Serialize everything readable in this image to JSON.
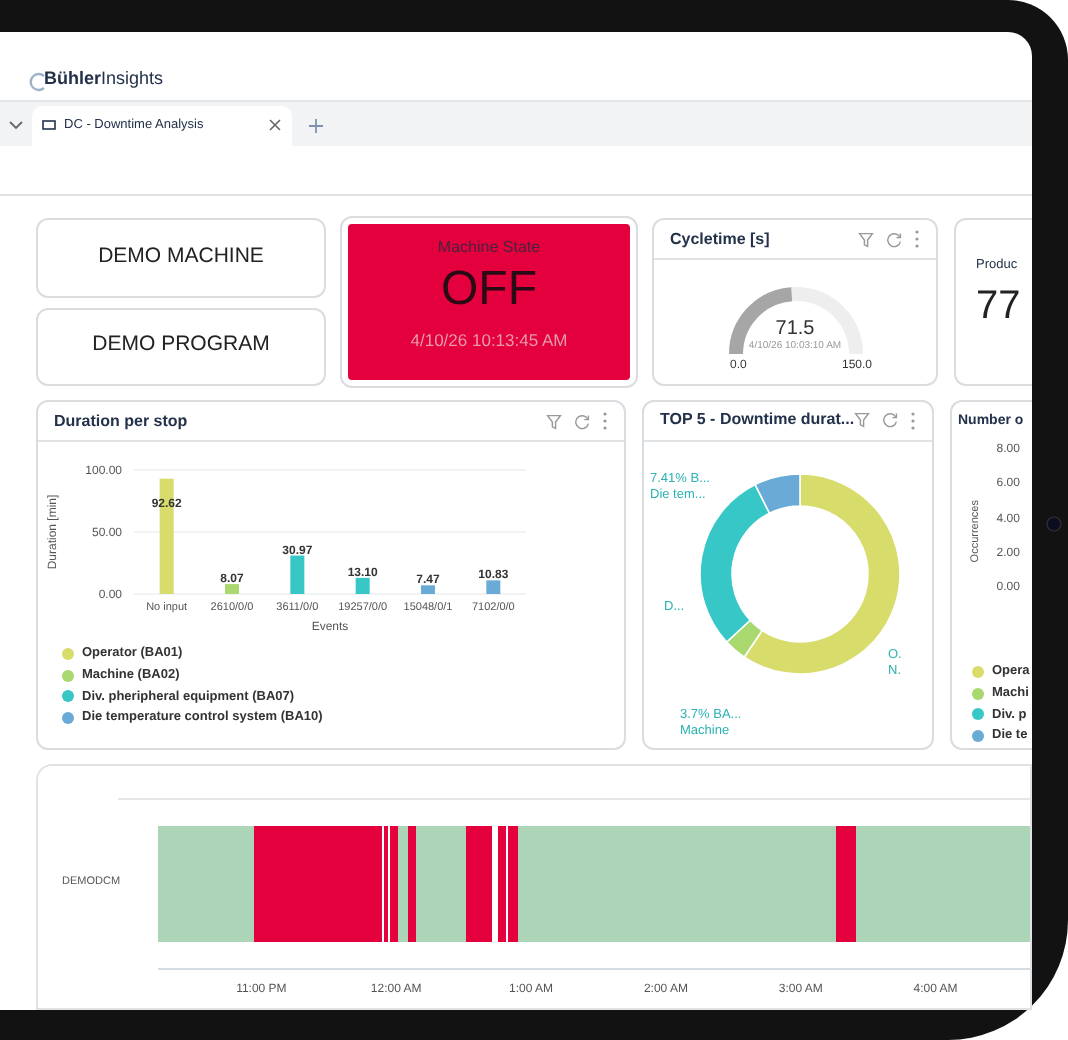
{
  "app": {
    "logo_bold": "Bühler",
    "logo_light": "Insights"
  },
  "tabs": [
    {
      "label": "DC - Downtime Analysis",
      "selected": true
    }
  ],
  "buttons": [
    "DEMO MACHINE",
    "DEMO PROGRAM"
  ],
  "machine_state": {
    "title": "Machine State",
    "value": "OFF",
    "timestamp": "4/10/26 10:13:45 AM",
    "off": true
  },
  "cycletime": {
    "title": "Cycletime [s]",
    "value": "71.5",
    "timestamp": "4/10/26 10:03:10 AM",
    "min": "0.0",
    "max": "150.0",
    "level": 0.477
  },
  "product_card": {
    "title": "Produc",
    "value": "77"
  },
  "duration_chart": {
    "title": "Duration per stop",
    "chart_data": {
      "type": "bar",
      "xlabel": "Events",
      "ylabel": "Duration [min]",
      "categories": [
        "No input",
        "2610/0/0",
        "3611/0/0",
        "19257/0/0",
        "15048/0/1",
        "7102/0/0"
      ],
      "series": [
        {
          "name": "Operator (BA01)",
          "color": "#d7dc6a",
          "values": [
            93,
            null,
            null,
            null,
            null,
            null
          ]
        },
        {
          "name": "Machine (BA02)",
          "color": "#a9d86e",
          "values": [
            null,
            8,
            null,
            null,
            null,
            null
          ]
        },
        {
          "name": "Div. pheripheral equipment (BA07)",
          "color": "#38c7c7",
          "values": [
            null,
            null,
            31,
            13,
            null,
            null
          ]
        },
        {
          "name": "Die temperature control system (BA10)",
          "color": "#6aaad6",
          "values": [
            null,
            null,
            null,
            null,
            7,
            11
          ]
        }
      ],
      "ylim": [
        0,
        100
      ],
      "yticks": [
        {
          "value": 0,
          "label": "0.00"
        },
        {
          "value": 50,
          "label": "50.00"
        },
        {
          "value": 100,
          "label": "100.00"
        }
      ],
      "value_labels": [
        "92.62",
        "8.07",
        "30.97",
        "13.10",
        "7.47",
        "10.83"
      ]
    }
  },
  "top5_chart": {
    "title": "TOP 5 - Downtime durat...",
    "chart_data": {
      "type": "donut",
      "values": [
        59.4,
        3.7,
        29.5,
        7.4
      ],
      "colors": [
        "#d7dc6a",
        "#a9d86e",
        "#38c7c7",
        "#6aaad6"
      ]
    },
    "slice_labels": [
      {
        "lines": [
          "7.41% B...",
          "Die tem..."
        ]
      },
      {
        "lines": [
          "D..."
        ]
      },
      {
        "lines": [
          "O.",
          "N."
        ]
      },
      {
        "lines": [
          "3.7% BA...",
          "Machine"
        ]
      }
    ]
  },
  "occurrence_card": {
    "title": "Number o",
    "ylabel": "Occurrences",
    "yticks": [
      "8.00",
      "6.00",
      "4.00",
      "2.00",
      "0.00"
    ],
    "legend": [
      {
        "label": "Opera",
        "color": "#d7dc6a"
      },
      {
        "label": "Machi",
        "color": "#a9d86e"
      },
      {
        "label": "Div. p",
        "color": "#38c7c7"
      },
      {
        "label": "Die te",
        "color": "#6aaad6"
      }
    ]
  },
  "timeline": {
    "row_label": "DEMODCM",
    "ticks": [
      "11:00 PM",
      "12:00 AM",
      "1:00 AM",
      "2:00 AM",
      "3:00 AM",
      "4:00 AM"
    ],
    "segments": [
      {
        "kind": "on"
      },
      {
        "kind": "off"
      },
      {
        "kind": "off"
      },
      {
        "kind": "off"
      },
      {
        "kind": "on"
      },
      {
        "kind": "off"
      },
      {
        "kind": "on"
      },
      {
        "kind": "off"
      },
      {
        "kind": "off"
      },
      {
        "kind": "off"
      },
      {
        "kind": "on"
      },
      {
        "kind": "off"
      },
      {
        "kind": "on"
      }
    ]
  }
}
